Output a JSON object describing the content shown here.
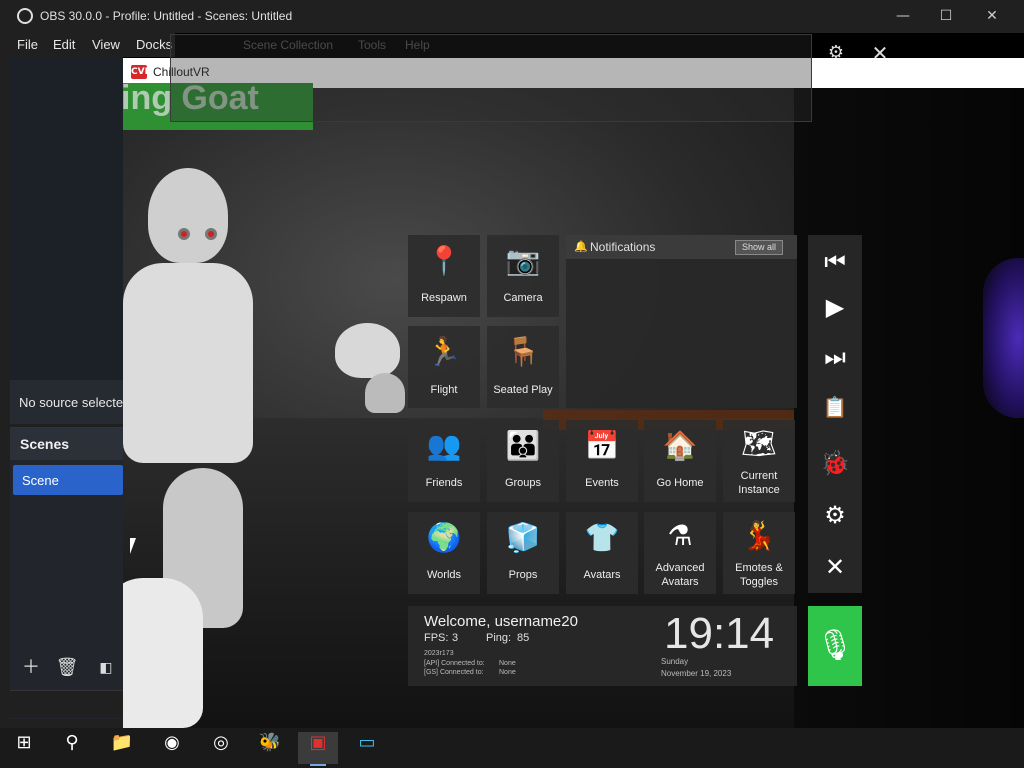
{
  "obs": {
    "title": "OBS 30.0.0 - Profile: Untitled - Scenes: Untitled",
    "menu": [
      "File",
      "Edit",
      "View",
      "Docks"
    ],
    "menu_faded": [
      "Scene Collection",
      "Tools",
      "Help"
    ],
    "no_source": "No source selected",
    "scenes_header": "Scenes",
    "scene_item": "Scene",
    "window_buttons": {
      "minimize": "—",
      "maximize": "☐",
      "close": "✕"
    }
  },
  "game": {
    "window_title": "ChilloutVR",
    "icon_text": "CVR",
    "banner_text": "ing Goat"
  },
  "quickmenu": {
    "tiles": {
      "respawn": "Respawn",
      "camera": "Camera",
      "flight": "Flight",
      "seated_play": "Seated Play",
      "friends": "Friends",
      "groups": "Groups",
      "events": "Events",
      "go_home": "Go Home",
      "current_instance": "Current Instance",
      "worlds": "Worlds",
      "props": "Props",
      "avatars": "Avatars",
      "advanced_avatars": "Advanced Avatars",
      "emotes_toggles": "Emotes & Toggles"
    },
    "notifications": {
      "title": "Notifications",
      "show_all": "Show all"
    },
    "welcome": {
      "greeting": "Welcome, username20",
      "fps_label": "FPS:",
      "fps_value": "3",
      "ping_label": "Ping:",
      "ping_value": "85",
      "build": "2023r173",
      "api_label": "[API] Connected to:",
      "api_value": "None",
      "gs_label": "[GS] Connected to:",
      "gs_value": "None",
      "time": "19:14",
      "day": "Sunday",
      "date": "November 19, 2023"
    }
  },
  "colors": {
    "accent_blue": "#2a63c9",
    "mic_green": "#2fc54a",
    "banner_green": "#2e8f33"
  }
}
